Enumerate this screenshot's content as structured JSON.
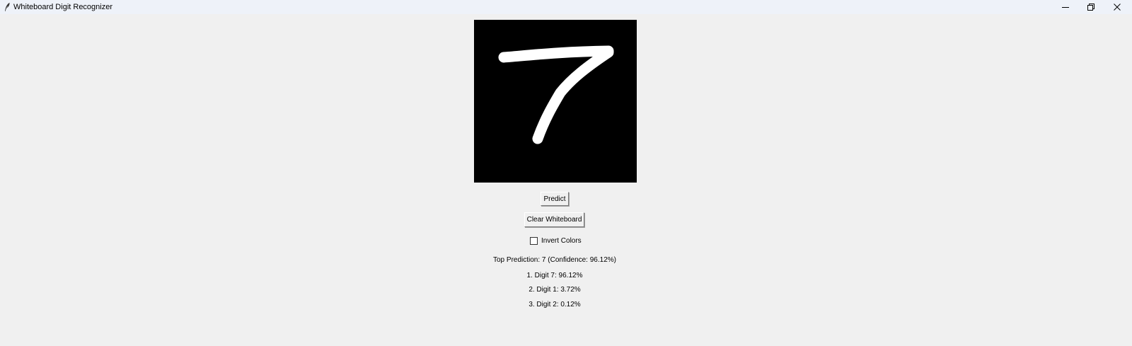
{
  "window": {
    "title": "Whiteboard Digit Recognizer",
    "icon": "feather-icon",
    "controls": [
      "minimize-icon",
      "restore-icon",
      "close-icon"
    ]
  },
  "whiteboard": {
    "background": "#000000",
    "stroke_color": "#ffffff",
    "drawn_digit": "7"
  },
  "buttons": {
    "predict_label": "Predict",
    "clear_label": "Clear Whiteboard"
  },
  "invert": {
    "label": "Invert Colors",
    "checked": false
  },
  "results": {
    "top_prediction": "Top Prediction: 7 (Confidence: 96.12%)",
    "items": [
      "1. Digit 7: 96.12%",
      "2. Digit 1: 3.72%",
      "3. Digit 2: 0.12%"
    ]
  }
}
